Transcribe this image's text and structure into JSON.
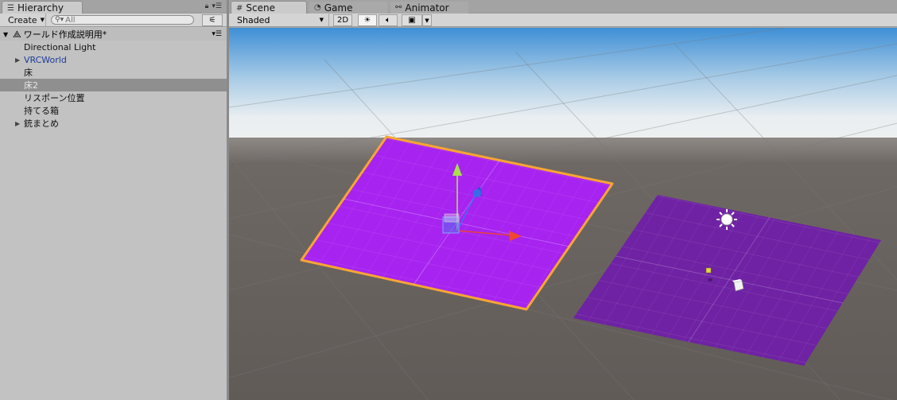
{
  "hierarchy": {
    "tab_label": "Hierarchy",
    "tab_icon": "list-icon",
    "create_label": "Create",
    "search_placeholder": "All",
    "scene_name": "ワールド作成説明用*",
    "items": [
      {
        "label": "Directional Light",
        "has_children": false,
        "selected": false,
        "prefab": false
      },
      {
        "label": "VRCWorld",
        "has_children": true,
        "selected": false,
        "prefab": true
      },
      {
        "label": "床",
        "has_children": false,
        "selected": false,
        "prefab": false
      },
      {
        "label": "床2",
        "has_children": false,
        "selected": true,
        "prefab": false
      },
      {
        "label": "リスポーン位置",
        "has_children": false,
        "selected": false,
        "prefab": false
      },
      {
        "label": "持てる箱",
        "has_children": false,
        "selected": false,
        "prefab": false
      },
      {
        "label": "銃まとめ",
        "has_children": true,
        "selected": false,
        "prefab": false
      }
    ]
  },
  "scene_view": {
    "tabs": [
      {
        "label": "Scene",
        "icon": "grid-icon",
        "active": true
      },
      {
        "label": "Game",
        "icon": "pacman-icon",
        "active": false
      },
      {
        "label": "Animator",
        "icon": "animator-icon",
        "active": false
      }
    ],
    "shading_mode": "Shaded",
    "btn_2d": "2D",
    "colors": {
      "selected_floor": "#a723f0",
      "other_floor": "#6f22a3",
      "selection_outline": "#f7a533",
      "sky": "#e9eef1",
      "ground": "#67615e"
    }
  }
}
